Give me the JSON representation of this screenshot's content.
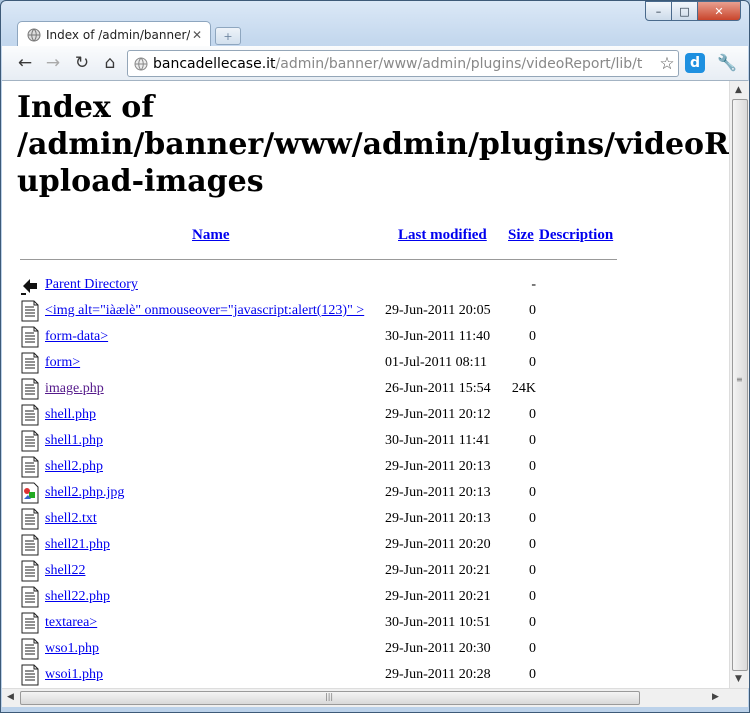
{
  "browser": {
    "tab_title": "Index of /admin/banner/www/admin/plugins/videoReport/lib/upload-images",
    "tab_title_display": "Index of /admin/banner/\\",
    "url_host": "bancadellecase.it",
    "url_path": "/admin/banner/www/admin/plugins/videoReport/lib/t",
    "extension_label": "d"
  },
  "page": {
    "heading": "Index of /admin/banner/www/admin/plugins/videoReport/lib/ upload-images",
    "columns": {
      "name": "Name",
      "last_modified": "Last modified",
      "size": "Size",
      "description": "Description"
    },
    "rows": [
      {
        "icon": "back",
        "name": "Parent Directory",
        "date": "",
        "size": "-"
      },
      {
        "icon": "text",
        "name": "<img alt=\"iàælè\" onmouseover=\"javascript:alert(123)\" >",
        "date": "29-Jun-2011 20:05",
        "size": "0"
      },
      {
        "icon": "text",
        "name": "form-data>",
        "date": "30-Jun-2011 11:40",
        "size": "0"
      },
      {
        "icon": "text",
        "name": "form>",
        "date": "01-Jul-2011 08:11",
        "size": "0"
      },
      {
        "icon": "text",
        "name": "image.php",
        "date": "26-Jun-2011 15:54",
        "size": "24K",
        "visited": true
      },
      {
        "icon": "text",
        "name": "shell.php",
        "date": "29-Jun-2011 20:12",
        "size": "0"
      },
      {
        "icon": "text",
        "name": "shell1.php",
        "date": "30-Jun-2011 11:41",
        "size": "0"
      },
      {
        "icon": "text",
        "name": "shell2.php",
        "date": "29-Jun-2011 20:13",
        "size": "0"
      },
      {
        "icon": "image",
        "name": "shell2.php.jpg",
        "date": "29-Jun-2011 20:13",
        "size": "0"
      },
      {
        "icon": "text",
        "name": "shell2.txt",
        "date": "29-Jun-2011 20:13",
        "size": "0"
      },
      {
        "icon": "text",
        "name": "shell21.php",
        "date": "29-Jun-2011 20:20",
        "size": "0"
      },
      {
        "icon": "text",
        "name": "shell22",
        "date": "29-Jun-2011 20:21",
        "size": "0"
      },
      {
        "icon": "text",
        "name": "shell22.php",
        "date": "29-Jun-2011 20:21",
        "size": "0"
      },
      {
        "icon": "text",
        "name": "textarea>",
        "date": "30-Jun-2011 10:51",
        "size": "0"
      },
      {
        "icon": "text",
        "name": "wso1.php",
        "date": "29-Jun-2011 20:30",
        "size": "0"
      },
      {
        "icon": "text",
        "name": "wsoi1.php",
        "date": "29-Jun-2011 20:28",
        "size": "0"
      }
    ]
  },
  "colors": {
    "link": "#0000ee",
    "visited": "#551a8b",
    "titlebar": "#c4d8ee"
  }
}
